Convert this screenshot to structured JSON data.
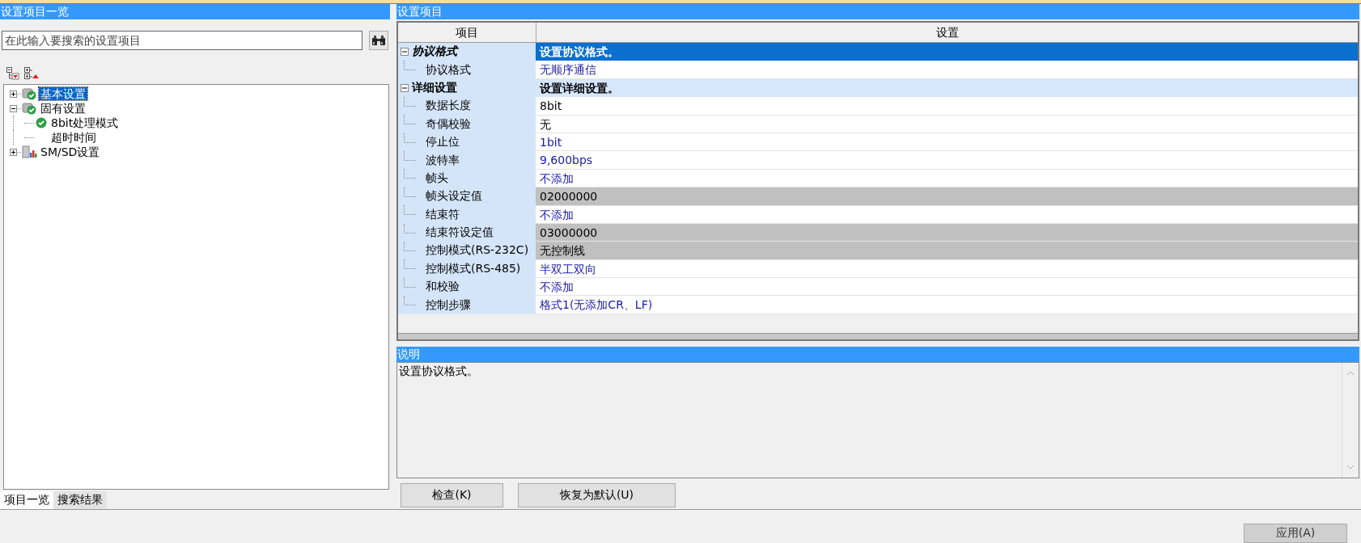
{
  "left_panel": {
    "title": "设置项目一览",
    "search": {
      "placeholder": "在此输入要搜索的设置项目"
    },
    "tree": [
      {
        "label": "基本设置",
        "kind": "category",
        "checked": true,
        "expanded": false,
        "selected": true
      },
      {
        "label": "固有设置",
        "kind": "category",
        "checked": true,
        "expanded": true,
        "selected": false,
        "children": [
          {
            "label": "8bit处理模式",
            "checked": true,
            "selected": false
          },
          {
            "label": "超时时间",
            "checked": false,
            "selected": false
          }
        ]
      },
      {
        "label": "SM/SD设置",
        "kind": "system",
        "expanded": false,
        "selected": false
      }
    ],
    "tabs": [
      {
        "label": "项目一览",
        "selected": true
      },
      {
        "label": "搜索结果",
        "selected": false
      }
    ]
  },
  "settings": {
    "title": "设置项目",
    "columns": [
      "项目",
      "设置"
    ],
    "groups": [
      {
        "label": "协议格式",
        "value": "设置协议格式。",
        "expanded": true,
        "selected": true,
        "items": [
          {
            "label": "协议格式",
            "value": "无顺序通信",
            "changed": true,
            "disabled": false
          }
        ]
      },
      {
        "label": "详细设置",
        "value": "设置详细设置。",
        "expanded": true,
        "selected": false,
        "items": [
          {
            "label": "数据长度",
            "value": "8bit",
            "changed": false,
            "disabled": false
          },
          {
            "label": "奇偶校验",
            "value": "无",
            "changed": false,
            "disabled": false
          },
          {
            "label": "停止位",
            "value": "1bit",
            "changed": true,
            "disabled": false
          },
          {
            "label": "波特率",
            "value": "9,600bps",
            "changed": true,
            "disabled": false
          },
          {
            "label": "帧头",
            "value": "不添加",
            "changed": true,
            "disabled": false
          },
          {
            "label": "帧头设定值",
            "value": "02000000",
            "changed": false,
            "disabled": true
          },
          {
            "label": "结束符",
            "value": "不添加",
            "changed": true,
            "disabled": false
          },
          {
            "label": "结束符设定值",
            "value": "03000000",
            "changed": false,
            "disabled": true
          },
          {
            "label": "控制模式(RS-232C)",
            "value": "无控制线",
            "changed": false,
            "disabled": true
          },
          {
            "label": "控制模式(RS-485)",
            "value": "半双工双向",
            "changed": true,
            "disabled": false
          },
          {
            "label": "和校验",
            "value": "不添加",
            "changed": true,
            "disabled": false
          },
          {
            "label": "控制步骤",
            "value": "格式1(无添加CR、LF)",
            "changed": true,
            "disabled": false
          }
        ]
      }
    ]
  },
  "description": {
    "title": "说明",
    "text": "设置协议格式。"
  },
  "buttons": [
    {
      "label": "检查(K)"
    },
    {
      "label": "恢复为默认(U)"
    }
  ],
  "apply_button": {
    "label": "应用(A)"
  }
}
